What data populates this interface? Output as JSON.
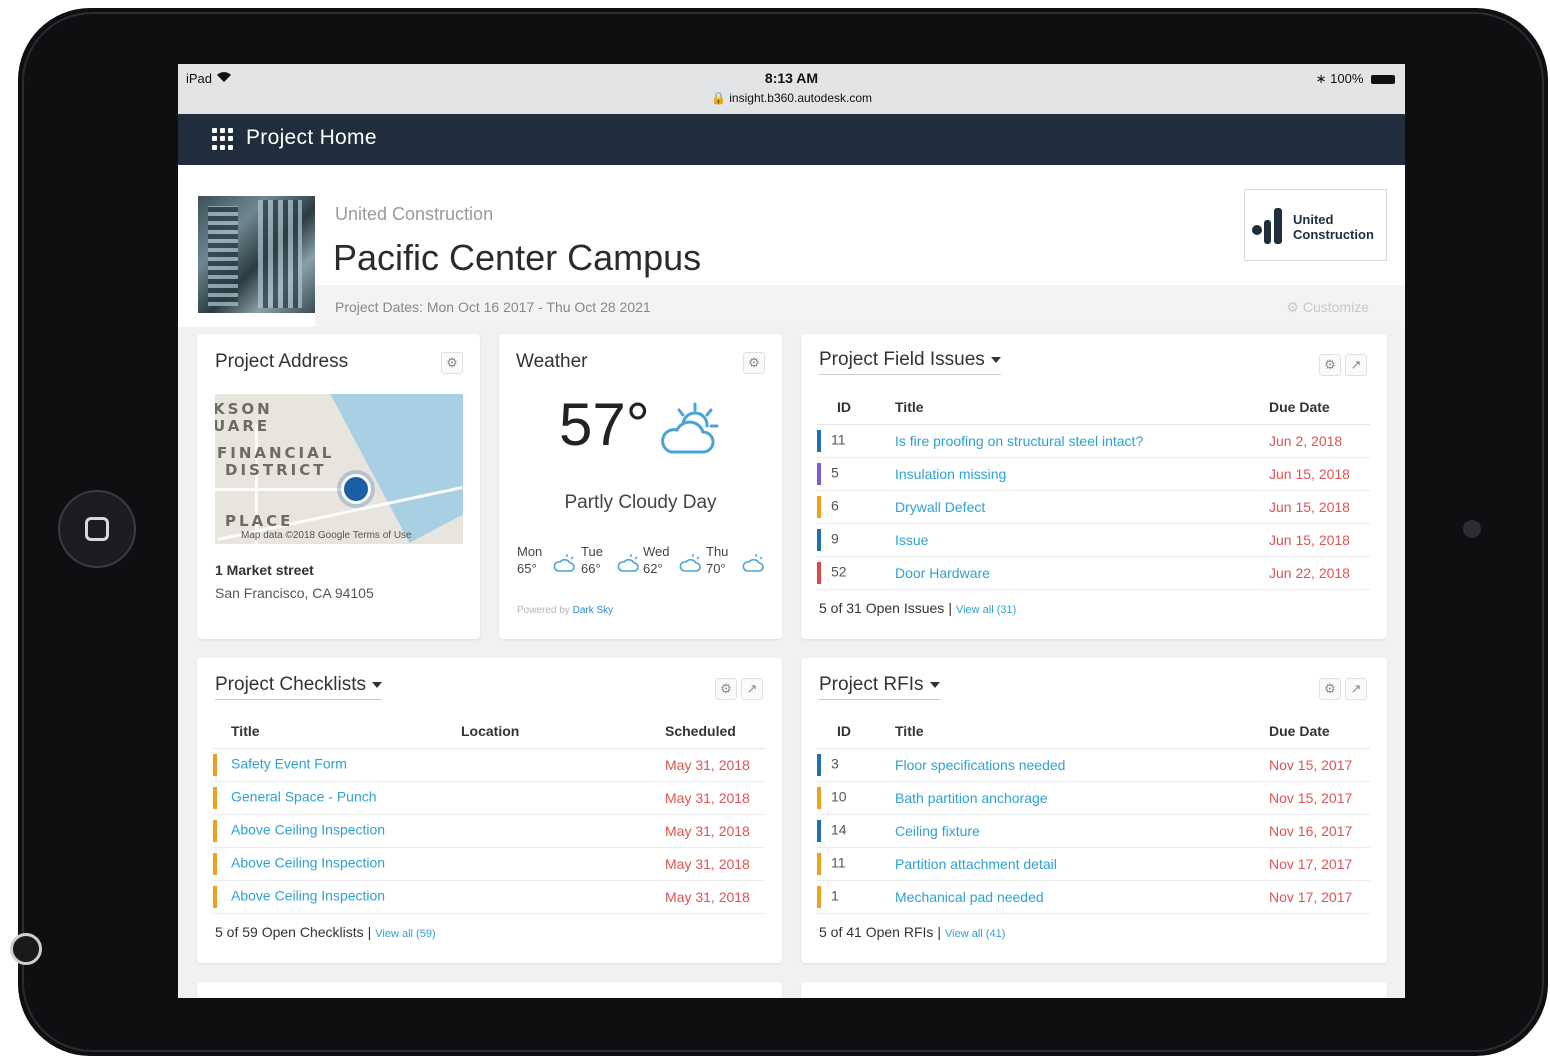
{
  "status_bar": {
    "device": "iPad",
    "time": "8:13 AM",
    "url": "insight.b360.autodesk.com",
    "battery": "100%"
  },
  "nav": {
    "title": "Project Home"
  },
  "header": {
    "company": "United Construction",
    "project": "Pacific Center Campus",
    "dates": "Project Dates: Mon Oct 16 2017 - Thu Oct 28 2021",
    "logo_line1": "United",
    "logo_line2": "Construction",
    "customize": "Customize"
  },
  "address_card": {
    "title": "Project Address",
    "map_labels": [
      "KSON",
      "UARE",
      "FINANCIAL",
      "DISTRICT",
      "PLACE"
    ],
    "map_credit": "Map data ©2018 Google   Terms of Use",
    "line1": "1 Market street",
    "line2": "San Francisco, CA 94105"
  },
  "weather_card": {
    "title": "Weather",
    "temp": "57°",
    "condition": "Partly Cloudy Day",
    "forecast": [
      {
        "day": "Mon",
        "temp": "65°"
      },
      {
        "day": "Tue",
        "temp": "66°"
      },
      {
        "day": "Wed",
        "temp": "62°"
      },
      {
        "day": "Thu",
        "temp": "70°"
      }
    ],
    "powered_prefix": "Powered by",
    "powered_brand": "Dark Sky",
    "icon": "partly-cloudy-icon"
  },
  "issues_card": {
    "title": "Project Field Issues",
    "columns": [
      "ID",
      "Title",
      "Due Date"
    ],
    "rows": [
      {
        "id": "11",
        "title": "Is fire proofing on structural steel intact?",
        "due": "Jun 2, 2018",
        "color": "#1f6fb5"
      },
      {
        "id": "5",
        "title": "Insulation missing",
        "due": "Jun 15, 2018",
        "color": "#7b5bd6"
      },
      {
        "id": "6",
        "title": "Drywall Defect",
        "due": "Jun 15, 2018",
        "color": "#f0a020"
      },
      {
        "id": "9",
        "title": "Issue",
        "due": "Jun 15, 2018",
        "color": "#1f6fb5"
      },
      {
        "id": "52",
        "title": "Door Hardware",
        "due": "Jun 22, 2018",
        "color": "#e04646"
      }
    ],
    "summary": "5 of 31 Open Issues",
    "view_all": "View all (31)"
  },
  "checklists_card": {
    "title": "Project Checklists",
    "columns": [
      "Title",
      "Location",
      "Scheduled"
    ],
    "rows": [
      {
        "title": "Safety Event Form",
        "location": "",
        "scheduled": "May 31, 2018",
        "color": "#f0a020"
      },
      {
        "title": "General Space - Punch",
        "location": "",
        "scheduled": "May 31, 2018",
        "color": "#f0a020"
      },
      {
        "title": "Above Ceiling Inspection",
        "location": "",
        "scheduled": "May 31, 2018",
        "color": "#f0a020"
      },
      {
        "title": "Above Ceiling Inspection",
        "location": "",
        "scheduled": "May 31, 2018",
        "color": "#f0a020"
      },
      {
        "title": "Above Ceiling Inspection",
        "location": "",
        "scheduled": "May 31, 2018",
        "color": "#f0a020"
      }
    ],
    "summary": "5 of 59 Open Checklists",
    "view_all": "View all (59)"
  },
  "rfis_card": {
    "title": "Project RFIs",
    "columns": [
      "ID",
      "Title",
      "Due Date"
    ],
    "rows": [
      {
        "id": "3",
        "title": "Floor specifications needed",
        "due": "Nov 15, 2017",
        "color": "#1f6fb5"
      },
      {
        "id": "10",
        "title": "Bath partition anchorage",
        "due": "Nov 15, 2017",
        "color": "#f0a020"
      },
      {
        "id": "14",
        "title": "Ceiling fixture",
        "due": "Nov 16, 2017",
        "color": "#1f6fb5"
      },
      {
        "id": "11",
        "title": "Partition attachment detail",
        "due": "Nov 17, 2017",
        "color": "#f0a020"
      },
      {
        "id": "1",
        "title": "Mechanical pad needed",
        "due": "Nov 17, 2017",
        "color": "#f0a020"
      }
    ],
    "summary": "5 of 41 Open RFIs",
    "view_all": "View all (41)"
  }
}
